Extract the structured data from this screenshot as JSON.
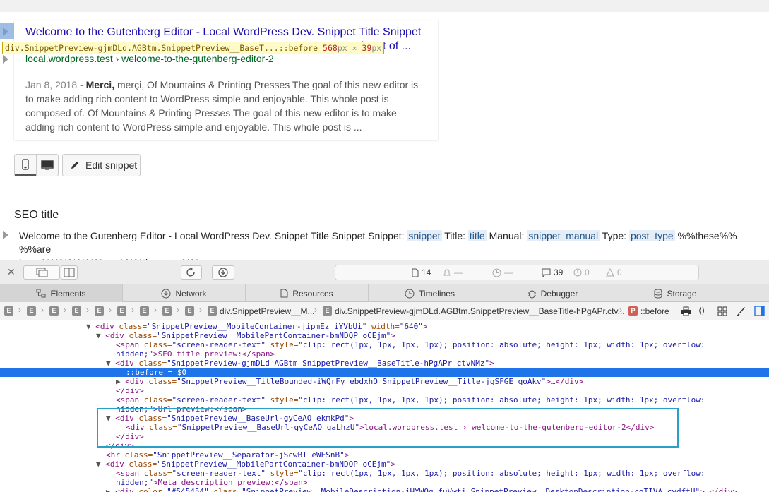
{
  "preview": {
    "title": "Welcome to the Gutenberg Editor - Local WordPress Dev. Snippet Title Snippet Snippet Title: title Manual: snippet of ...",
    "title_line1": "Welcome to the Gutenberg Editor - Local WordPress Dev. Snippet Title Snippet",
    "title_line2_tail": "snippet of ...",
    "url": "local.wordpress.test › welcome-to-the-gutenberg-editor-2",
    "date": "Jan 8, 2018 -",
    "desc_bold": "Merci,",
    "desc_rest": " merçi, Of Mountains & Printing Presses The goal of this new editor is to make adding rich content to WordPress simple and enjoyable. This whole post is composed of. Of Mountains & Printing Presses The goal of this new editor is to make adding rich content to WordPress simple and enjoyable. This whole post is ..."
  },
  "inspector_tooltip": {
    "selector": "div.SnippetPreview-gjmDLd.AGBtm.SnippetPreview__BaseT...::before",
    "width": "568",
    "height": "39",
    "unit": "px",
    "times": "×"
  },
  "mode_buttons": {
    "mobile": "mobile-icon",
    "desktop": "desktop-icon"
  },
  "edit_snippet": {
    "label": "Edit snippet"
  },
  "seo": {
    "label": "SEO title",
    "text_a": "Welcome to the Gutenberg Editor - Local WordPress Dev. Snippet Title Snippet Snippet: ",
    "tag1": "snippet",
    "text_b": " Title: ",
    "tag2": "title",
    "text_c": " Manual: ",
    "tag3": "snippet_manual",
    "text_d": " Type: ",
    "tag4": "post_type",
    "text_e": " %%these%% %%are",
    "line2": "here %%%%%%% and %%there too%%"
  },
  "devtools": {
    "status": {
      "resources": "14",
      "requests": "—",
      "time": "—",
      "logs": "39",
      "errors": "0",
      "warnings": "0"
    },
    "tabs": [
      "Elements",
      "Network",
      "Resources",
      "Timelines",
      "Debugger",
      "Storage"
    ],
    "breadcrumb": {
      "e_label": "E",
      "node1": "div.SnippetPreview__M...",
      "node2": "div.SnippetPreview-gjmDLd.AGBtm.SnippetPreview__BaseTitle-hPgAPr.ctv...",
      "p_label": "P",
      "node3": "::before"
    },
    "code_lines": [
      [
        "▼ ",
        "<div ",
        "class=",
        "\"SnippetPreview__MobileContainer-jipmEz iYVbUi\"",
        " width=",
        "\"640\"",
        ">"
      ],
      [
        "▼ ",
        "<div ",
        "class=",
        "\"SnippetPreview__MobilePartContainer-bmNDQP oCEjm\"",
        "",
        "",
        ">"
      ],
      [
        "",
        "<span ",
        "class=",
        "\"screen-reader-text\"",
        " style=",
        "\"clip: rect(1px, 1px, 1px, 1px); position: absolute; height: 1px; width: 1px; overflow:",
        ""
      ],
      [
        "",
        "",
        "",
        "hidden;\"",
        "",
        "",
        ">SEO title preview:</span>"
      ],
      [
        "▼ ",
        "<div ",
        "class=",
        "\"SnippetPreview-gjmDLd AGBtm SnippetPreview__BaseTitle-hPgAPr ctvNMz\"",
        "",
        "",
        ">"
      ],
      [
        "",
        "::before",
        " = ",
        "$0",
        "",
        "",
        ""
      ],
      [
        "▶ ",
        "<div ",
        "class=",
        "\"SnippetPreview__TitleBounded-iWQrFy ebdxhO SnippetPreview__Title-jgSFGE qoAkv\"",
        "",
        "",
        ">…</div>"
      ],
      [
        "",
        "</div>",
        "",
        "",
        "",
        "",
        ""
      ],
      [
        "",
        "<span ",
        "class=",
        "\"screen-reader-text\"",
        " style=",
        "\"clip: rect(1px, 1px, 1px, 1px); position: absolute; height: 1px; width: 1px; overflow:",
        ""
      ],
      [
        "",
        "",
        "",
        "hidden;\"",
        "",
        "",
        ">Url preview:</span>"
      ],
      [
        "▼ ",
        "<div ",
        "class=",
        "\"SnippetPreview__BaseUrl-gyCeAO ekmkPd\"",
        "",
        "",
        ">"
      ],
      [
        "",
        "<div ",
        "class=",
        "\"SnippetPreview__BaseUrl-gyCeAO gaLhzU\"",
        "",
        "",
        ">local.wordpress.test › welcome-to-the-gutenberg-editor-2</div>"
      ],
      [
        "",
        "</div>",
        "",
        "",
        "",
        "",
        ""
      ],
      [
        "",
        "</div>",
        "",
        "",
        "",
        "",
        ""
      ],
      [
        "",
        "<hr ",
        "class=",
        "\"SnippetPreview__Separator-jScwBT eWESnB\"",
        "",
        "",
        ">"
      ],
      [
        "▼ ",
        "<div ",
        "class=",
        "\"SnippetPreview__MobilePartContainer-bmNDQP oCEjm\"",
        "",
        "",
        ">"
      ],
      [
        "",
        "<span ",
        "class=",
        "\"screen-reader-text\"",
        " style=",
        "\"clip: rect(1px, 1px, 1px, 1px); position: absolute; height: 1px; width: 1px; overflow:",
        ""
      ],
      [
        "",
        "",
        "",
        "hidden;\"",
        "",
        "",
        ">Meta description preview:</span>"
      ],
      [
        "▶ ",
        "<div ",
        "color=",
        "\"#545454\"",
        " class=",
        "\"SnippetPreview__MobileDescription-jHYWQg fuVwti SnippetPreview__DesktopDescription-cgTIVA cvdftU\"",
        ">…</div>"
      ]
    ]
  }
}
